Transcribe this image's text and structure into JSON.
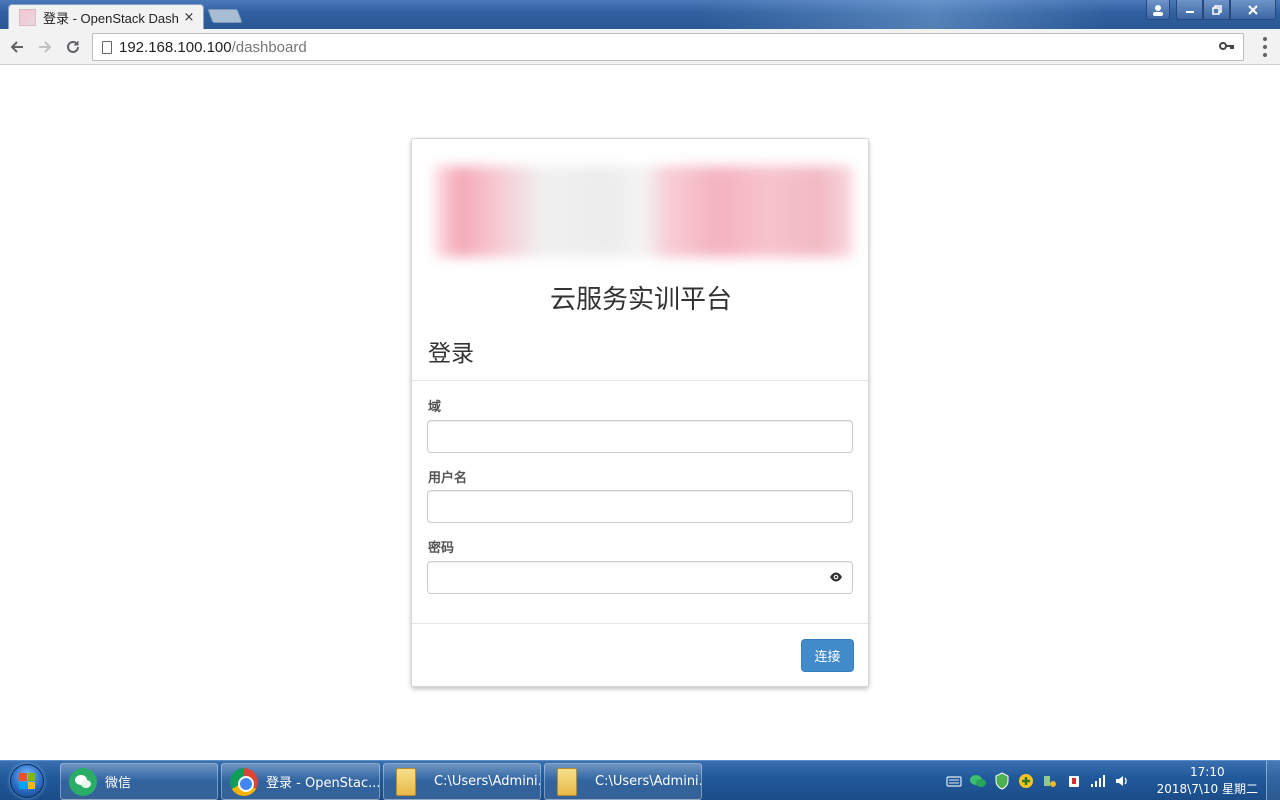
{
  "browser": {
    "tab_title": "登录 - OpenStack Dash",
    "tab_close": "×",
    "url_host": "192.168.100.100",
    "url_path": "/dashboard"
  },
  "login": {
    "brand_title": "云服务实训平台",
    "heading": "登录",
    "fields": {
      "domain_label": "域",
      "domain_value": "",
      "username_label": "用户名",
      "username_value": "",
      "password_label": "密码",
      "password_value": ""
    },
    "submit_label": "连接"
  },
  "taskbar": {
    "items": [
      {
        "label": "微信",
        "icon": "wechat-icon"
      },
      {
        "label": "登录 - OpenStac...",
        "icon": "chrome-icon"
      },
      {
        "label": "C:\\Users\\Admini...",
        "icon": "folder-icon"
      },
      {
        "label": "C:\\Users\\Admini...",
        "icon": "folder-icon"
      }
    ],
    "clock_time": "17:10",
    "clock_date": "2018\\7\\10 星期二"
  },
  "colors": {
    "primary_button": "#428bca",
    "taskbar": "#215a9c"
  }
}
